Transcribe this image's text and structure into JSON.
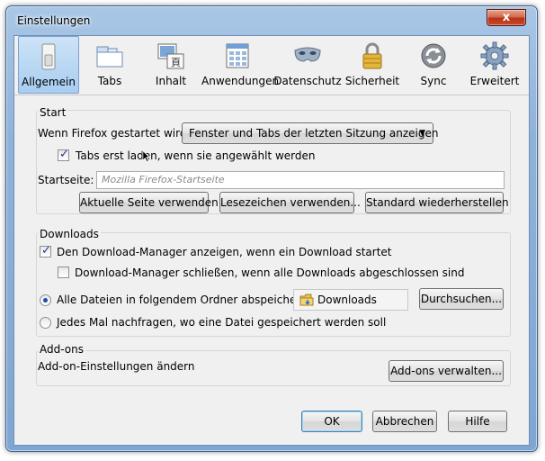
{
  "window": {
    "title": "Einstellungen",
    "close_glyph": "x"
  },
  "toolbar": {
    "items": [
      {
        "label": "Allgemein",
        "icon": "switch-icon",
        "active": true
      },
      {
        "label": "Tabs",
        "icon": "tabs-icon",
        "active": false
      },
      {
        "label": "Inhalt",
        "icon": "content-icon",
        "active": false
      },
      {
        "label": "Anwendungen",
        "icon": "applications-icon",
        "active": false
      },
      {
        "label": "Datenschutz",
        "icon": "mask-icon",
        "active": false
      },
      {
        "label": "Sicherheit",
        "icon": "lock-icon",
        "active": false
      },
      {
        "label": "Sync",
        "icon": "sync-icon",
        "active": false
      },
      {
        "label": "Erweitert",
        "icon": "gear-icon",
        "active": false
      }
    ]
  },
  "start": {
    "group_title": "Start",
    "startup_label": "Wenn Firefox gestartet wird:",
    "startup_value": "Fenster und Tabs der letzten Sitzung anzeigen",
    "lazy_tabs_label": "Tabs erst laden, wenn sie angewählt werden",
    "lazy_tabs_checked": true,
    "homepage_label": "Startseite:",
    "homepage_placeholder": "Mozilla Firefox-Startseite",
    "btn_current": "Aktuelle Seite verwenden",
    "btn_bookmark": "Lesezeichen verwenden...",
    "btn_restore": "Standard wiederherstellen"
  },
  "downloads": {
    "group_title": "Downloads",
    "show_manager_label": "Den Download-Manager anzeigen, wenn ein Download startet",
    "show_manager_checked": true,
    "close_manager_label": "Download-Manager schließen, wenn alle Downloads abgeschlossen sind",
    "close_manager_checked": false,
    "save_to_label": "Alle Dateien in folgendem Ordner abspeichern:",
    "save_to_selected": true,
    "folder_name": "Downloads",
    "browse_button": "Durchsuchen...",
    "ask_label": "Jedes Mal nachfragen, wo eine Datei gespeichert werden soll",
    "ask_selected": false
  },
  "addons": {
    "group_title": "Add-ons",
    "settings_label": "Add-on-Einstellungen ändern",
    "manage_button": "Add-ons verwalten..."
  },
  "footer": {
    "ok": "OK",
    "cancel": "Abbrechen",
    "help": "Hilfe"
  },
  "colors": {
    "accent": "#3c7fb1",
    "active_tab": "#a8cdf1",
    "checkmark": "#21398a"
  }
}
